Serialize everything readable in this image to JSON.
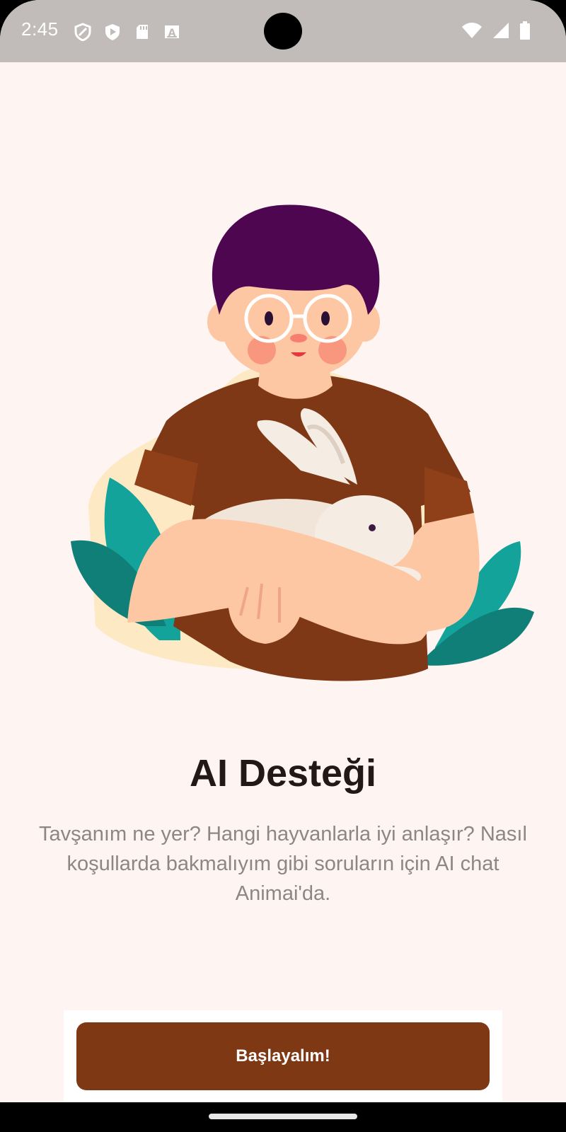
{
  "status_bar": {
    "time": "2:45",
    "left_icons": [
      "shield-icon",
      "play-protect-icon",
      "sd-card-icon",
      "keyboard-a-icon"
    ],
    "right_icons": [
      "wifi-icon",
      "signal-icon",
      "battery-icon"
    ]
  },
  "onboarding": {
    "illustration": "boy-holding-rabbit-illustration",
    "title": "AI Desteği",
    "description": "Tavşanım ne yer? Hangi hayvanlarla iyi anlaşır? Nasıl koşullarda bakmalıyım gibi soruların için AI chat Animai'da.",
    "button_label": "Başlayalım!"
  },
  "colors": {
    "background": "#fef5f3",
    "status_bar": "#c1bcb9",
    "button": "#7e3814",
    "title": "#231815",
    "description": "#8c8785"
  }
}
